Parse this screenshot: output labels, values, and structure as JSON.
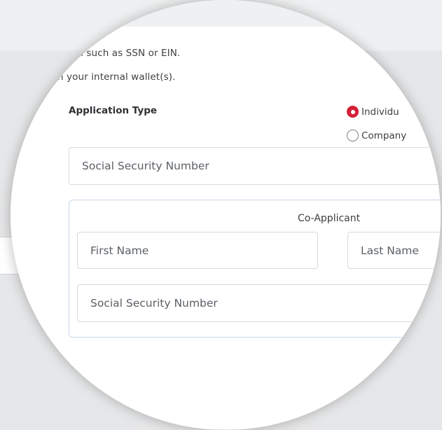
{
  "info_lines": [
    "on such as SSN or EIN.",
    "n your internal wallet(s)."
  ],
  "application_type": {
    "label": "Application Type",
    "options": [
      {
        "label": "Individu",
        "selected": true
      },
      {
        "label": "Company",
        "selected": false
      }
    ]
  },
  "applicant": {
    "ssn_placeholder": "Social Security Number"
  },
  "co_applicant": {
    "title": "Co-Applicant",
    "first_name_placeholder": "First Name",
    "last_name_placeholder": "Last Name",
    "ssn_placeholder": "Social Security Number"
  },
  "colors": {
    "accent": "#d31f37",
    "border": "#d6dadf",
    "co_border": "#c7d7ea"
  }
}
